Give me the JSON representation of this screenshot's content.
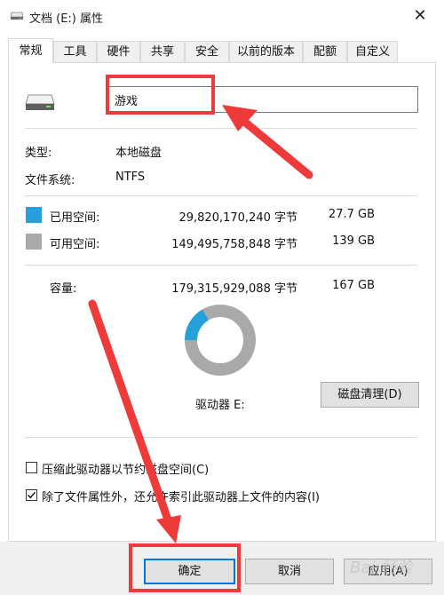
{
  "window": {
    "title": "文档 (E:) 属性",
    "close_glyph": "✕"
  },
  "tabs": [
    {
      "label": "常规",
      "active": true
    },
    {
      "label": "工具"
    },
    {
      "label": "硬件"
    },
    {
      "label": "共享"
    },
    {
      "label": "安全"
    },
    {
      "label": "以前的版本"
    },
    {
      "label": "配额"
    },
    {
      "label": "自定义"
    }
  ],
  "general": {
    "drive_name": "游戏",
    "type_label": "类型:",
    "type_value": "本地磁盘",
    "fs_label": "文件系统:",
    "fs_value": "NTFS",
    "used_label": "已用空间:",
    "used_bytes": "29,820,170,240 字节",
    "used_size": "27.7 GB",
    "free_label": "可用空间:",
    "free_bytes": "149,495,758,848 字节",
    "free_size": "139 GB",
    "capacity_label": "容量:",
    "capacity_bytes": "179,315,929,088 字节",
    "capacity_size": "167 GB",
    "drive_label": "驱动器 E:",
    "cleanup_button": "磁盘清理(D)",
    "compress_label": "压缩此驱动器以节约磁盘空间(C)",
    "compress_checked": false,
    "index_label": "除了文件属性外，还允许索引此驱动器上文件的内容(I)",
    "index_checked": true
  },
  "colors": {
    "used": "#26a0da",
    "free": "#a9a9a9",
    "annotation": "#ef3a3a"
  },
  "usage": {
    "used_fraction": 0.166,
    "free_fraction": 0.834
  },
  "footer": {
    "ok_button": "确定",
    "cancel_button": "取消",
    "apply_button": "应用(A)"
  },
  "watermark": {
    "text": "Bai 经验"
  }
}
